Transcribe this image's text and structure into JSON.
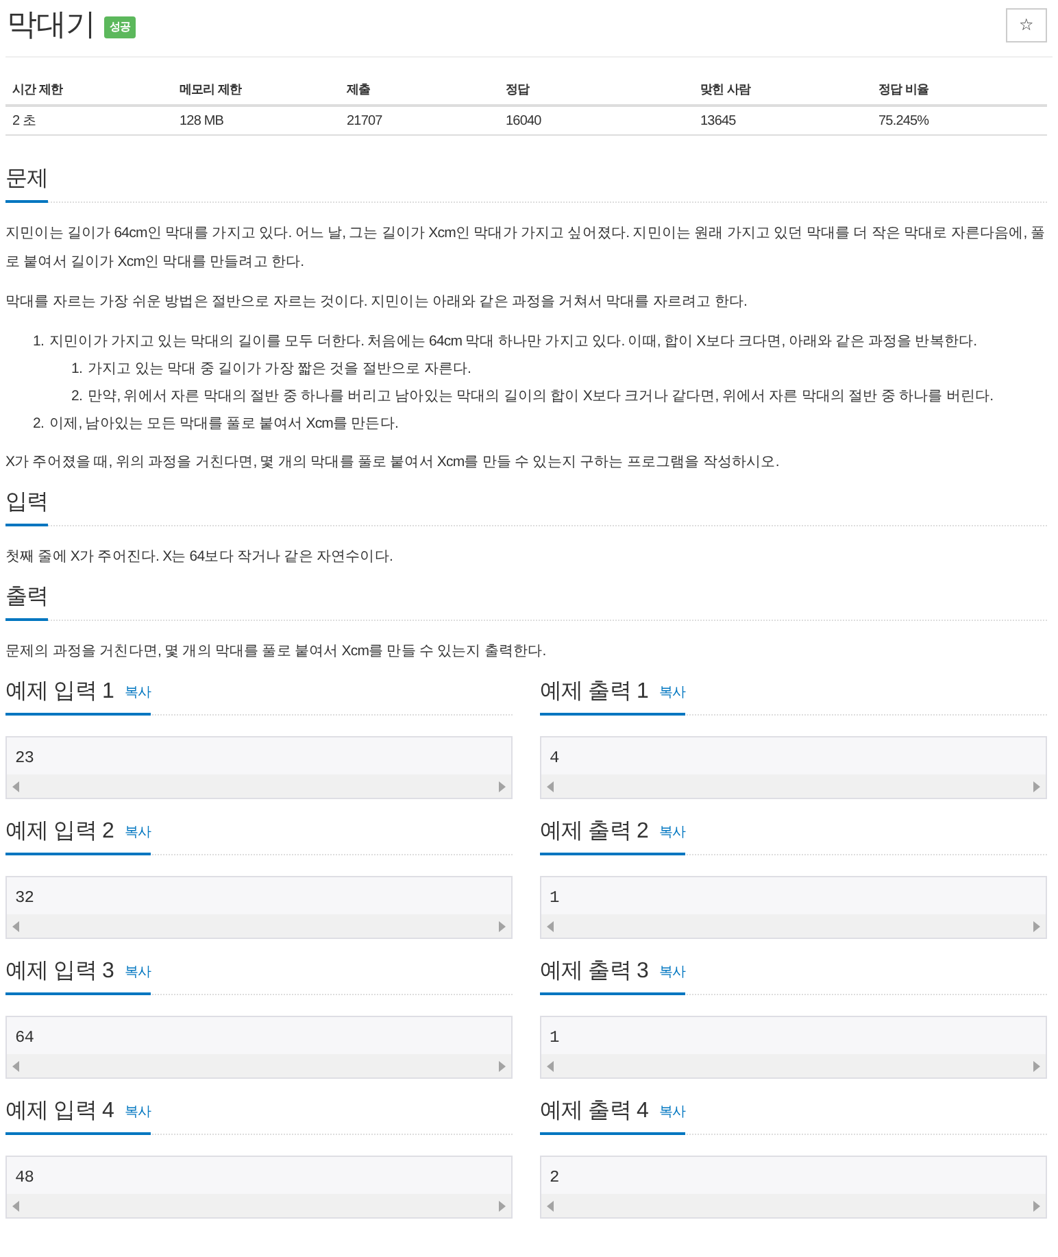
{
  "title": "막대기",
  "badge": "성공",
  "star_button": "☆",
  "table": {
    "columns": [
      "시간 제한",
      "메모리 제한",
      "제출",
      "정답",
      "맞힌 사람",
      "정답 비율"
    ],
    "rows": [
      [
        "2 초",
        "128 MB",
        "21707",
        "16040",
        "13645",
        "75.245%"
      ]
    ]
  },
  "sections": [
    {
      "heading": "문제",
      "blocks": [
        {
          "kind": "paragraph",
          "text": "지민이는 길이가 64cm인 막대를 가지고 있다. 어느 날, 그는 길이가 Xcm인 막대가 가지고 싶어졌다. 지민이는 원래 가지고 있던 막대를 더 작은 막대로 자른다음에, 풀로 붙여서 길이가 Xcm인 막대를 만들려고 한다."
        },
        {
          "kind": "paragraph",
          "text": "막대를 자르는 가장 쉬운 방법은 절반으로 자르는 것이다. 지민이는 아래와 같은 과정을 거쳐서 막대를 자르려고 한다."
        },
        {
          "kind": "list",
          "items": [
            {
              "marker": "1.",
              "text": "지민이가 가지고 있는 막대의 길이를 모두 더한다. 처음에는 64cm 막대 하나만 가지고 있다. 이때, 합이 X보다 크다면, 아래와 같은 과정을 반복한다.",
              "children": [
                {
                  "marker": "1.",
                  "text": "가지고 있는 막대 중 길이가 가장 짧은 것을 절반으로 자른다."
                },
                {
                  "marker": "2.",
                  "text": "만약, 위에서 자른 막대의 절반 중 하나를 버리고 남아있는 막대의 길이의 합이 X보다 크거나 같다면, 위에서 자른 막대의 절반 중 하나를 버린다."
                }
              ]
            },
            {
              "marker": "2.",
              "text": "이제, 남아있는 모든 막대를 풀로 붙여서 Xcm를 만든다."
            }
          ]
        },
        {
          "kind": "paragraph",
          "text": "X가 주어졌을 때, 위의 과정을 거친다면, 몇 개의 막대를 풀로 붙여서 Xcm를 만들 수 있는지 구하는 프로그램을 작성하시오."
        }
      ]
    },
    {
      "heading": "입력",
      "blocks": [
        {
          "kind": "paragraph",
          "text": "첫째 줄에 X가 주어진다. X는 64보다 작거나 같은 자연수이다."
        }
      ]
    },
    {
      "heading": "출력",
      "blocks": [
        {
          "kind": "paragraph",
          "text": "문제의 과정을 거친다면, 몇 개의 막대를 풀로 붙여서 Xcm를 만들 수 있는지 출력한다."
        }
      ]
    }
  ],
  "samples": [
    [
      {
        "heading": "예제 입력 1",
        "copy": "복사",
        "value": "23"
      },
      {
        "heading": "예제 출력 1",
        "copy": "복사",
        "value": "4"
      }
    ],
    [
      {
        "heading": "예제 입력 2",
        "copy": "복사",
        "value": "32"
      },
      {
        "heading": "예제 출력 2",
        "copy": "복사",
        "value": "1"
      }
    ],
    [
      {
        "heading": "예제 입력 3",
        "copy": "복사",
        "value": "64"
      },
      {
        "heading": "예제 출력 3",
        "copy": "복사",
        "value": "1"
      }
    ],
    [
      {
        "heading": "예제 입력 4",
        "copy": "복사",
        "value": "48"
      },
      {
        "heading": "예제 출력 4",
        "copy": "복사",
        "value": "2"
      }
    ]
  ]
}
